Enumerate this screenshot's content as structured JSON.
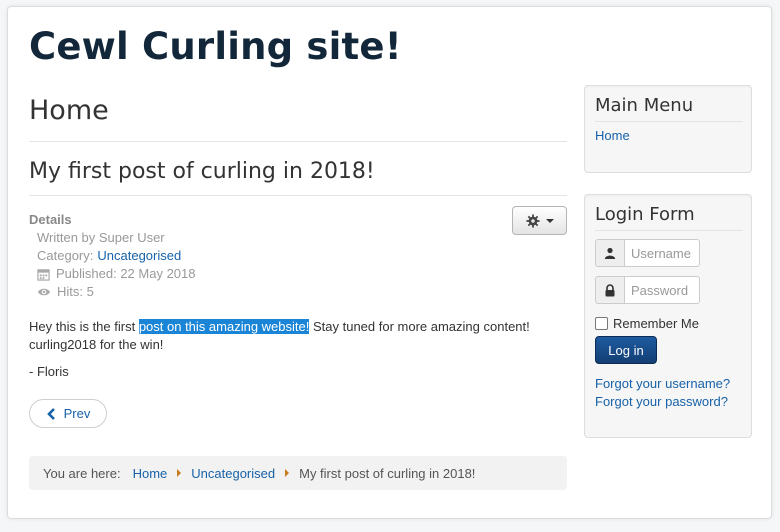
{
  "site": {
    "title": "Cewl Curling site!"
  },
  "page": {
    "heading": "Home"
  },
  "article": {
    "title": "My first post of curling in 2018!",
    "details_label": "Details",
    "written_by": "Written by Super User",
    "category_prefix": "Category:",
    "category": "Uncategorised",
    "published": "Published: 22 May 2018",
    "hits": "Hits: 5",
    "body_before": "Hey this is the first ",
    "body_highlight": "post on this amazing website!",
    "body_after": " Stay tuned for more amazing content! curling2018 for the win!",
    "signoff": "- Floris",
    "prev_label": "Prev"
  },
  "breadcrumb": {
    "prefix": "You are here:",
    "items": [
      "Home",
      "Uncategorised",
      "My first post of curling in 2018!"
    ]
  },
  "main_menu": {
    "title": "Main Menu",
    "items": [
      "Home"
    ]
  },
  "login_form": {
    "title": "Login Form",
    "username_placeholder": "Username",
    "password_placeholder": "Password",
    "remember_label": "Remember Me",
    "login_label": "Log in",
    "forgot_username": "Forgot your username?",
    "forgot_password": "Forgot your password?"
  },
  "colors": {
    "link": "#1762a8",
    "highlight": "#1a84d6",
    "login_button": "#133f74",
    "breadcrumb_separator": "#c87a1f"
  },
  "icons": [
    "gear-icon",
    "chevron-left-icon",
    "calendar-icon",
    "eye-icon",
    "user-icon",
    "lock-icon",
    "caret-down-icon"
  ]
}
